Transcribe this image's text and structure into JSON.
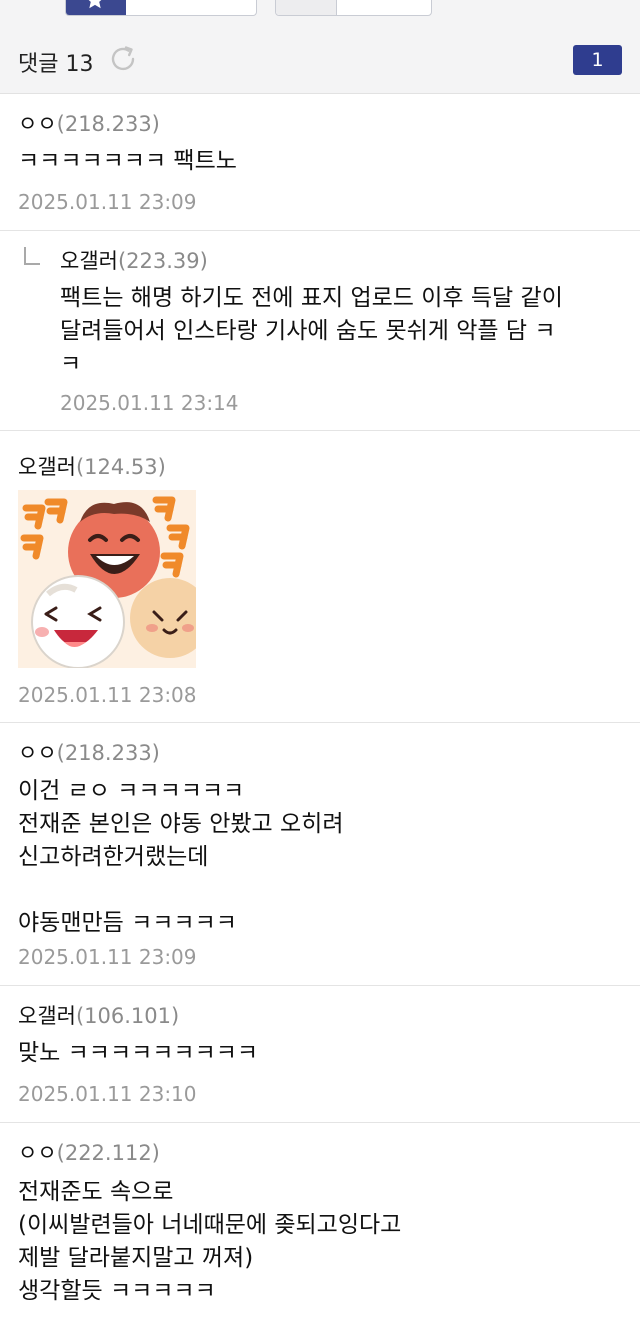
{
  "header": {
    "title": "댓글 13",
    "page_number": "1"
  },
  "comments": [
    {
      "name": "ㅇㅇ",
      "ip": "(218.233)",
      "text": "ㅋㅋㅋㅋㅋㅋㅋ 팩트노",
      "date": "2025.01.11 23:09"
    },
    {
      "name": "오갤러",
      "ip": "(223.39)",
      "text": "팩트는 해명 하기도 전에 표지 업로드 이후 득달 같이\n달려들어서 인스타랑 기사에 숨도 못쉬게 악플 담 ㅋ\nㅋ",
      "date": "2025.01.11 23:14",
      "is_reply": true
    },
    {
      "name": "오갤러",
      "ip": "(124.53)",
      "image": "laughing-emoticon",
      "date": "2025.01.11 23:08"
    },
    {
      "name": "ㅇㅇ",
      "ip": "(218.233)",
      "text": "이건 ㄹㅇ ㅋㅋㅋㅋㅋㅋ\n전재준 본인은 야동 안봤고 오히려\n신고하려한거랬는데\n\n야동맨만듬 ㅋㅋㅋㅋㅋ",
      "date": "2025.01.11 23:09"
    },
    {
      "name": "오갤러",
      "ip": "(106.101)",
      "text": "맞노 ㅋㅋㅋㅋㅋㅋㅋㅋㅋ",
      "date": "2025.01.11 23:10"
    },
    {
      "name": "ㅇㅇ",
      "ip": "(222.112)",
      "text": "전재준도 속으로\n(이씨발련들아 너네때문에 좆되고잉다고\n제발 달라붙지말고 꺼져)\n생각할듯 ㅋㅋㅋㅋㅋ"
    }
  ],
  "colors": {
    "accent": "#2f3d8f",
    "ip_text": "#8a8a8a",
    "date_text": "#9a9a9a",
    "header_bg": "#f4f4f5"
  }
}
